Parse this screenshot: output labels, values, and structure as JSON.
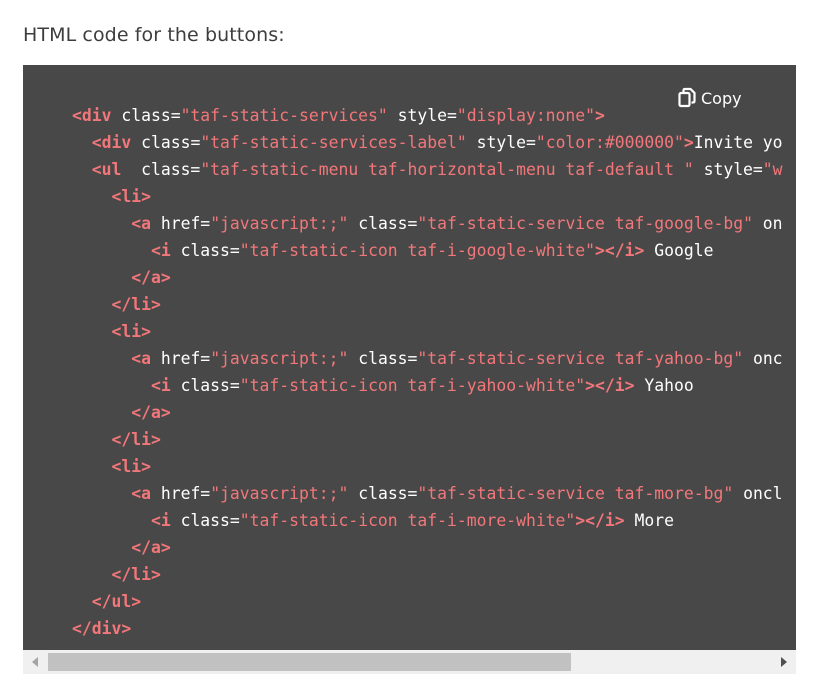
{
  "heading": "HTML code for the buttons:",
  "copy_button": {
    "label": "Copy",
    "icon": "copy-icon"
  },
  "colors": {
    "code_background": "#484848",
    "tag": "#f2777a",
    "string": "#f2777a",
    "text": "#ffffff"
  },
  "code_lines": [
    [
      {
        "t": "tag",
        "v": "<div"
      },
      {
        "t": "attr",
        "v": " class="
      },
      {
        "t": "str",
        "v": "\"taf-static-services\""
      },
      {
        "t": "attr",
        "v": " style="
      },
      {
        "t": "str",
        "v": "\"display:none\""
      },
      {
        "t": "tag",
        "v": ">"
      }
    ],
    [
      {
        "t": "text",
        "v": "  "
      },
      {
        "t": "tag",
        "v": "<div"
      },
      {
        "t": "attr",
        "v": " class="
      },
      {
        "t": "str",
        "v": "\"taf-static-services-label\""
      },
      {
        "t": "attr",
        "v": " style="
      },
      {
        "t": "str",
        "v": "\"color:#000000\""
      },
      {
        "t": "tag",
        "v": ">"
      },
      {
        "t": "text",
        "v": "Invite yo"
      }
    ],
    [
      {
        "t": "text",
        "v": "  "
      },
      {
        "t": "tag",
        "v": "<ul"
      },
      {
        "t": "attr",
        "v": "  class="
      },
      {
        "t": "str",
        "v": "\"taf-static-menu taf-horizontal-menu taf-default \""
      },
      {
        "t": "attr",
        "v": " style="
      },
      {
        "t": "str",
        "v": "\"w"
      }
    ],
    [
      {
        "t": "text",
        "v": "    "
      },
      {
        "t": "tag",
        "v": "<li>"
      }
    ],
    [
      {
        "t": "text",
        "v": "      "
      },
      {
        "t": "tag",
        "v": "<a"
      },
      {
        "t": "attr",
        "v": " href="
      },
      {
        "t": "str",
        "v": "\"javascript:;\""
      },
      {
        "t": "attr",
        "v": " class="
      },
      {
        "t": "str",
        "v": "\"taf-static-service taf-google-bg\""
      },
      {
        "t": "attr",
        "v": " on"
      }
    ],
    [
      {
        "t": "text",
        "v": "        "
      },
      {
        "t": "tag",
        "v": "<i"
      },
      {
        "t": "attr",
        "v": " class="
      },
      {
        "t": "str",
        "v": "\"taf-static-icon taf-i-google-white\""
      },
      {
        "t": "tag",
        "v": "></i>"
      },
      {
        "t": "text",
        "v": " Google"
      }
    ],
    [
      {
        "t": "text",
        "v": "      "
      },
      {
        "t": "tag",
        "v": "</a>"
      }
    ],
    [
      {
        "t": "text",
        "v": "    "
      },
      {
        "t": "tag",
        "v": "</li>"
      }
    ],
    [
      {
        "t": "text",
        "v": "    "
      },
      {
        "t": "tag",
        "v": "<li>"
      }
    ],
    [
      {
        "t": "text",
        "v": "      "
      },
      {
        "t": "tag",
        "v": "<a"
      },
      {
        "t": "attr",
        "v": " href="
      },
      {
        "t": "str",
        "v": "\"javascript:;\""
      },
      {
        "t": "attr",
        "v": " class="
      },
      {
        "t": "str",
        "v": "\"taf-static-service taf-yahoo-bg\""
      },
      {
        "t": "attr",
        "v": " onc"
      }
    ],
    [
      {
        "t": "text",
        "v": "        "
      },
      {
        "t": "tag",
        "v": "<i"
      },
      {
        "t": "attr",
        "v": " class="
      },
      {
        "t": "str",
        "v": "\"taf-static-icon taf-i-yahoo-white\""
      },
      {
        "t": "tag",
        "v": "></i>"
      },
      {
        "t": "text",
        "v": " Yahoo"
      }
    ],
    [
      {
        "t": "text",
        "v": "      "
      },
      {
        "t": "tag",
        "v": "</a>"
      }
    ],
    [
      {
        "t": "text",
        "v": "    "
      },
      {
        "t": "tag",
        "v": "</li>"
      }
    ],
    [
      {
        "t": "text",
        "v": "    "
      },
      {
        "t": "tag",
        "v": "<li>"
      }
    ],
    [
      {
        "t": "text",
        "v": "      "
      },
      {
        "t": "tag",
        "v": "<a"
      },
      {
        "t": "attr",
        "v": " href="
      },
      {
        "t": "str",
        "v": "\"javascript:;\""
      },
      {
        "t": "attr",
        "v": " class="
      },
      {
        "t": "str",
        "v": "\"taf-static-service taf-more-bg\""
      },
      {
        "t": "attr",
        "v": " oncl"
      }
    ],
    [
      {
        "t": "text",
        "v": "        "
      },
      {
        "t": "tag",
        "v": "<i"
      },
      {
        "t": "attr",
        "v": " class="
      },
      {
        "t": "str",
        "v": "\"taf-static-icon taf-i-more-white\""
      },
      {
        "t": "tag",
        "v": "></i>"
      },
      {
        "t": "text",
        "v": " More"
      }
    ],
    [
      {
        "t": "text",
        "v": "      "
      },
      {
        "t": "tag",
        "v": "</a>"
      }
    ],
    [
      {
        "t": "text",
        "v": "    "
      },
      {
        "t": "tag",
        "v": "</li>"
      }
    ],
    [
      {
        "t": "text",
        "v": "  "
      },
      {
        "t": "tag",
        "v": "</ul>"
      }
    ],
    [
      {
        "t": "tag",
        "v": "</div>"
      }
    ]
  ],
  "scrollbar": {
    "left_arrow_icon": "scroll-left-arrow-icon",
    "right_arrow_icon": "scroll-right-arrow-icon"
  }
}
